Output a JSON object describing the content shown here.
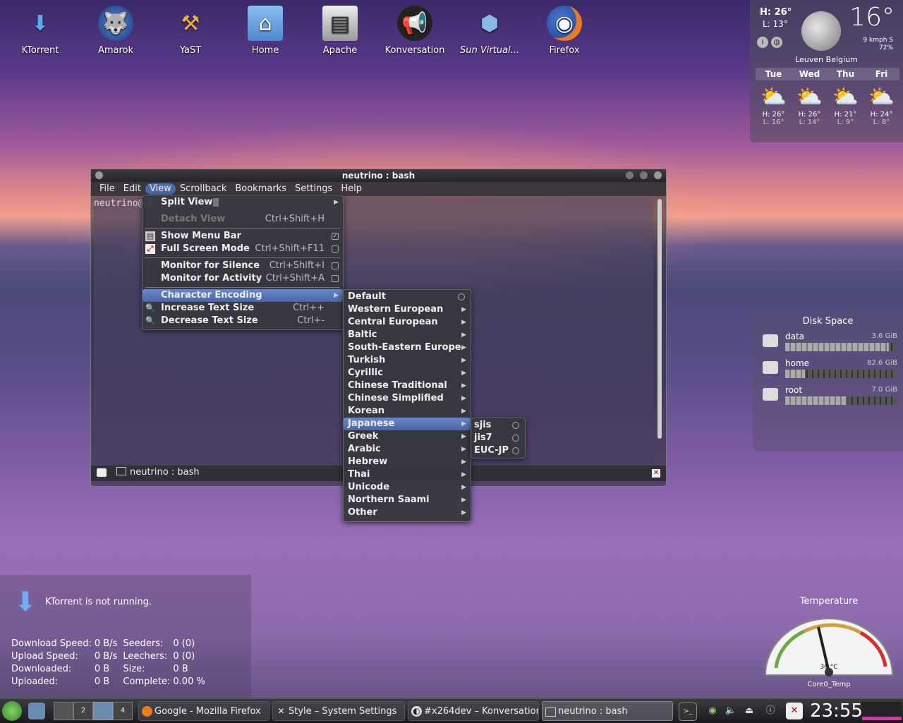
{
  "desktop_icons": [
    {
      "label": "KTorrent",
      "icon": "ktorrent-icon"
    },
    {
      "label": "Amarok",
      "icon": "amarok-icon"
    },
    {
      "label": "YaST",
      "icon": "yast-icon"
    },
    {
      "label": "Home",
      "icon": "home-folder-icon"
    },
    {
      "label": "Apache",
      "icon": "apache-icon"
    },
    {
      "label": "Konversation",
      "icon": "konversation-icon"
    },
    {
      "label": "Sun Virtual...",
      "icon": "virtualbox-icon"
    },
    {
      "label": "Firefox",
      "icon": "firefox-icon"
    }
  ],
  "weather": {
    "high": "H: 26°",
    "low": "L: 13°",
    "current_temp": "16°",
    "wind": "9 kmph S",
    "humidity": "72%",
    "location": "Leuven Belgium",
    "forecast": [
      {
        "day": "Tue",
        "high": "H: 26°",
        "low": "L: 16°"
      },
      {
        "day": "Wed",
        "high": "H: 26°",
        "low": "L: 14°"
      },
      {
        "day": "Thu",
        "high": "H: 21°",
        "low": "L: 9°"
      },
      {
        "day": "Fri",
        "high": "H: 24°",
        "low": "L: 8°"
      }
    ]
  },
  "disk_space": {
    "title": "Disk Space",
    "drives": [
      {
        "name": "data",
        "size": "3.6 GiB",
        "used_fraction": 0.93
      },
      {
        "name": "home",
        "size": "82.6 GiB",
        "used_fraction": 0.18
      },
      {
        "name": "root",
        "size": "7.0 GiB",
        "used_fraction": 0.55
      }
    ]
  },
  "temperature": {
    "title": "Temperature",
    "value": "36 °C",
    "sensor": "Core0_Temp"
  },
  "ktorrent": {
    "message": "KTorrent is not running.",
    "rows": [
      [
        "Download Speed:",
        "0 B/s",
        "Seeders:",
        "0 (0)"
      ],
      [
        "Upload Speed:",
        "0 B/s",
        "Leechers:",
        "0 (0)"
      ],
      [
        "Downloaded:",
        "0 B",
        "Size:",
        "0 B"
      ],
      [
        "Uploaded:",
        "0 B",
        "Complete:",
        "0.00 %"
      ]
    ]
  },
  "konsole": {
    "title": "neutrino : bash",
    "menubar": [
      "File",
      "Edit",
      "View",
      "Scrollback",
      "Bookmarks",
      "Settings",
      "Help"
    ],
    "prompt": "neutrino@ne",
    "tab_label": "neutrino : bash"
  },
  "view_menu": [
    {
      "label": "Split View",
      "shortcut": "",
      "submenu": true
    },
    {
      "label": "Detach View",
      "shortcut": "Ctrl+Shift+H",
      "disabled": true
    },
    {
      "label": "Show Menu Bar",
      "shortcut": "",
      "checked": true
    },
    {
      "label": "Full Screen Mode",
      "shortcut": "Ctrl+Shift+F11"
    },
    {
      "label": "Monitor for Silence",
      "shortcut": "Ctrl+Shift+I"
    },
    {
      "label": "Monitor for Activity",
      "shortcut": "Ctrl+Shift+A"
    },
    {
      "label": "Character Encoding",
      "shortcut": "",
      "submenu": true
    },
    {
      "label": "Increase Text Size",
      "shortcut": "Ctrl++"
    },
    {
      "label": "Decrease Text Size",
      "shortcut": "Ctrl+-"
    }
  ],
  "encoding_menu": [
    "Default",
    "Western European",
    "Central European",
    "Baltic",
    "South-Eastern Europe",
    "Turkish",
    "Cyrillic",
    "Chinese Traditional",
    "Chinese Simplified",
    "Korean",
    "Japanese",
    "Greek",
    "Arabic",
    "Hebrew",
    "Thai",
    "Unicode",
    "Northern Saami",
    "Other"
  ],
  "japanese_menu": [
    "sjis",
    "jis7",
    "EUC-JP"
  ],
  "taskbar": {
    "pager": [
      "2",
      "4"
    ],
    "tasks": [
      {
        "label": "Google - Mozilla Firefox",
        "icon": "firefox-icon"
      },
      {
        "label": "Style – System Settings",
        "icon": "settings-icon"
      },
      {
        "label": "#x264dev – Konversation",
        "icon": "konversation-icon"
      },
      {
        "label": "neutrino : bash",
        "icon": "terminal-icon",
        "active": true
      }
    ],
    "clock": "23:55"
  }
}
